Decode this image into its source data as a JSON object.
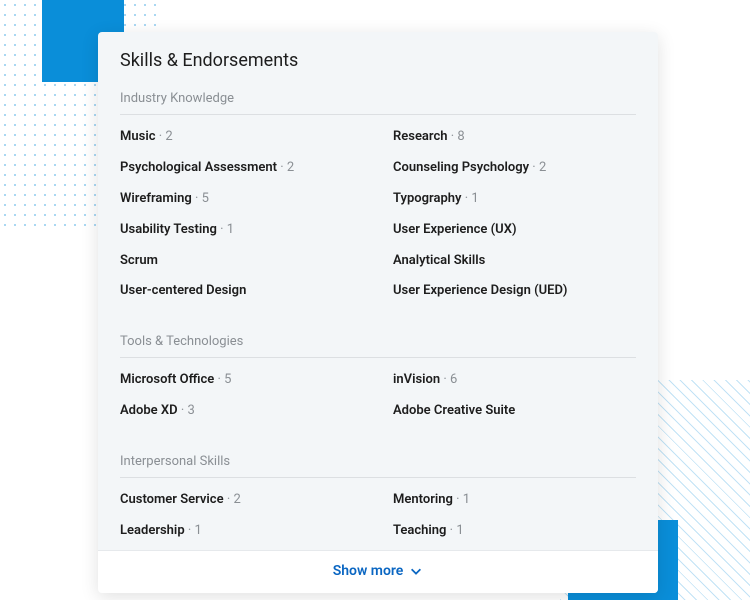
{
  "header": {
    "title": "Skills & Endorsements"
  },
  "sections": [
    {
      "title": "Industry Knowledge",
      "skills": [
        {
          "name": "Music",
          "count": 2
        },
        {
          "name": "Research",
          "count": 8
        },
        {
          "name": "Psychological Assessment",
          "count": 2
        },
        {
          "name": "Counseling Psychology",
          "count": 2
        },
        {
          "name": "Wireframing",
          "count": 5
        },
        {
          "name": "Typography",
          "count": 1
        },
        {
          "name": "Usability Testing",
          "count": 1
        },
        {
          "name": "User Experience (UX)",
          "count": null
        },
        {
          "name": "Scrum",
          "count": null
        },
        {
          "name": "Analytical Skills",
          "count": null
        },
        {
          "name": "User-centered Design",
          "count": null
        },
        {
          "name": "User Experience Design (UED)",
          "count": null
        }
      ]
    },
    {
      "title": "Tools & Technologies",
      "skills": [
        {
          "name": "Microsoft Office",
          "count": 5
        },
        {
          "name": "inVision",
          "count": 6
        },
        {
          "name": "Adobe XD",
          "count": 3
        },
        {
          "name": "Adobe Creative Suite",
          "count": null
        }
      ]
    },
    {
      "title": "Interpersonal Skills",
      "skills": [
        {
          "name": "Customer Service",
          "count": 2
        },
        {
          "name": "Mentoring",
          "count": 1
        },
        {
          "name": "Leadership",
          "count": 1
        },
        {
          "name": "Teaching",
          "count": 1
        }
      ]
    }
  ],
  "footer": {
    "show_more_label": "Show more"
  }
}
